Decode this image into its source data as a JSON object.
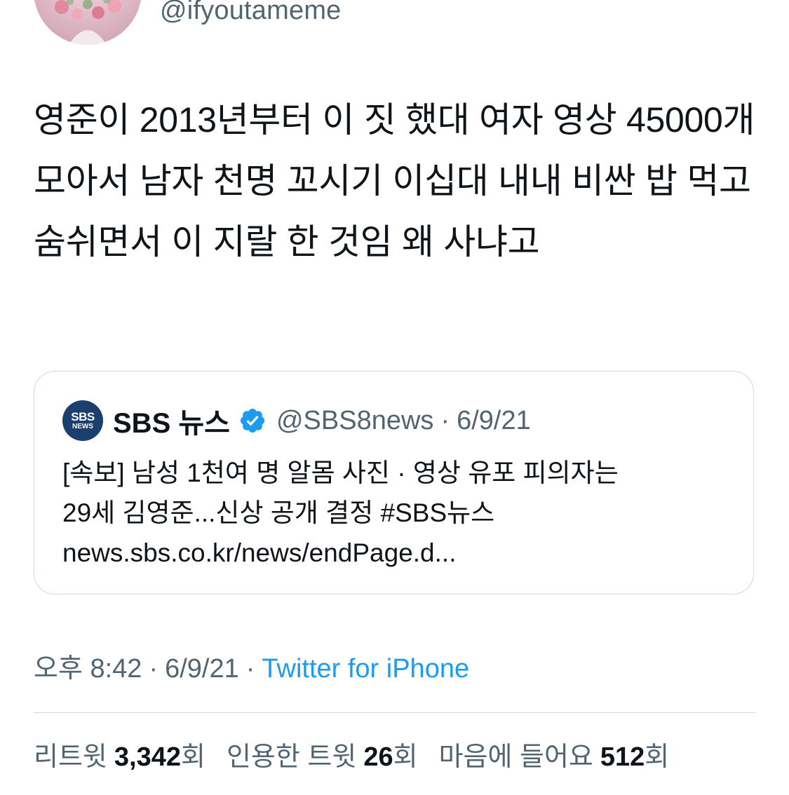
{
  "author": {
    "handle": "@ifyoutameme",
    "avatar_icon": "profile-avatar"
  },
  "tweet": {
    "text": "영준이 2013년부터 이 짓 했대 여자 영상 45000개 모아서 남자 천명 꼬시기 이십대 내내 비싼 밥 먹고 숨쉬면서 이 지랄 한 것임 왜 사냐고"
  },
  "quote": {
    "logo_top": "SBS",
    "logo_bottom": "NEWS",
    "name": "SBS 뉴스",
    "verified_icon": "verified-badge-icon",
    "handle": "@SBS8news",
    "dot": "·",
    "date": "6/9/21",
    "line1": "[속보] 남성 1천여 명 알몸 사진 · 영상 유포 피의자는",
    "line2": "29세 김영준...신상 공개 결정 #SBS뉴스",
    "line3": "news.sbs.co.kr/news/endPage.d..."
  },
  "meta": {
    "time": "오후 8:42",
    "sep1": "·",
    "date": "6/9/21",
    "sep2": "·",
    "source": "Twitter for iPhone"
  },
  "stats": {
    "retweets_label": "리트윗",
    "retweets_count": "3,342",
    "retweets_unit": "회",
    "quotes_label": "인용한 트윗",
    "quotes_count": "26",
    "quotes_unit": "회",
    "likes_label": "마음에 들어요",
    "likes_count": "512",
    "likes_unit": "회"
  },
  "colors": {
    "text_primary": "#0f1419",
    "text_secondary": "#536471",
    "link": "#1d9bf0",
    "border": "#cfd9de",
    "sbs_logo_bg": "#1b3f6e"
  }
}
